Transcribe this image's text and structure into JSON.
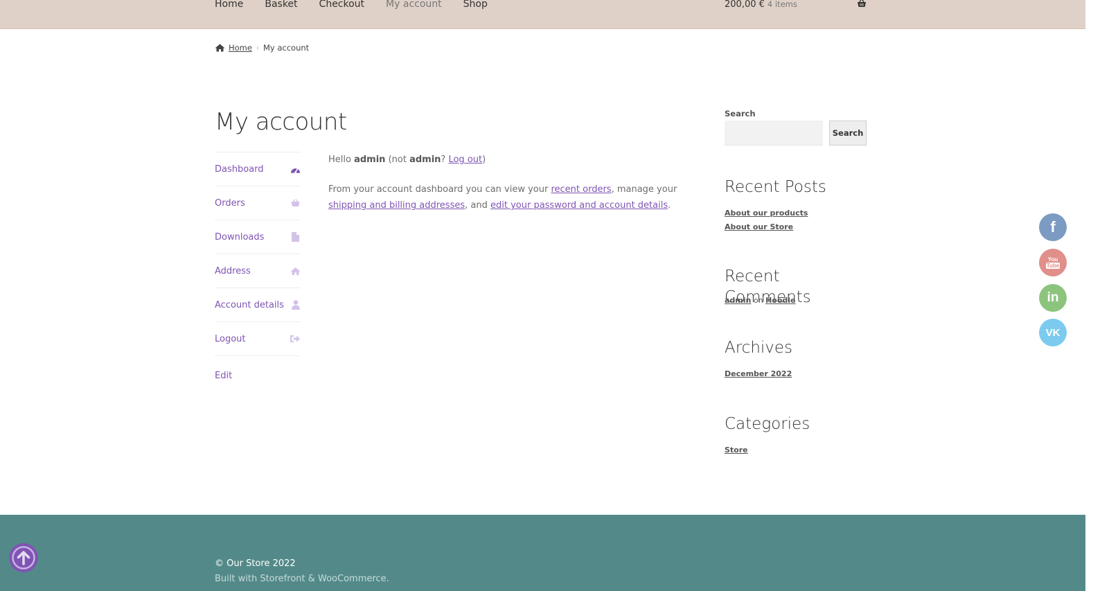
{
  "nav": {
    "items": [
      {
        "label": "Home"
      },
      {
        "label": "Basket"
      },
      {
        "label": "Checkout"
      },
      {
        "label": "My account",
        "current": true
      },
      {
        "label": "Shop"
      }
    ]
  },
  "cart": {
    "amount": "200,00 €",
    "count": "4 items",
    "icon": "basket-icon"
  },
  "breadcrumb": {
    "home": "Home",
    "current": "My account"
  },
  "page": {
    "title": "My account"
  },
  "account_nav": {
    "items": [
      {
        "label": "Dashboard",
        "icon": "dashboard-icon"
      },
      {
        "label": "Orders",
        "icon": "basket-icon"
      },
      {
        "label": "Downloads",
        "icon": "file-icon"
      },
      {
        "label": "Address",
        "icon": "home-icon"
      },
      {
        "label": "Account details",
        "icon": "user-icon"
      },
      {
        "label": "Logout",
        "icon": "sign-out-icon"
      }
    ],
    "edit": "Edit"
  },
  "content": {
    "hello": "Hello ",
    "user": "admin",
    "not_open": " (not ",
    "not_user": "admin",
    "question": "? ",
    "logout": "Log out",
    "close": ")",
    "dash_prefix": "From your account dashboard you can view your ",
    "recent_orders": "recent orders",
    "manage": ", manage your ",
    "addresses": "shipping and billing addresses",
    "and": ", and ",
    "edit_details": "edit your password and account details",
    "period": "."
  },
  "sidebar": {
    "search_label": "Search",
    "search_button": "Search",
    "recent_posts_title": "Recent Posts",
    "recent_posts": [
      "About our products",
      "About our Store"
    ],
    "recent_comments_title": "Recent Comments",
    "comment_author": "admin",
    "comment_on": " on ",
    "comment_post": "Hoodie",
    "archives_title": "Archives",
    "archive": "December 2022",
    "categories_title": "Categories",
    "category": "Store"
  },
  "social": {
    "facebook": "f",
    "youtube_top": "You",
    "youtube_bottom": "Tube",
    "linkedin": "in",
    "vk": "VK"
  },
  "footer": {
    "copyright": "© Our Store 2022",
    "built_with": "Built with Storefront & WooCommerce."
  },
  "colors": {
    "accent": "#7f54b3",
    "header_bg": "#dfd1c8",
    "footer_bg": "#538a89"
  }
}
